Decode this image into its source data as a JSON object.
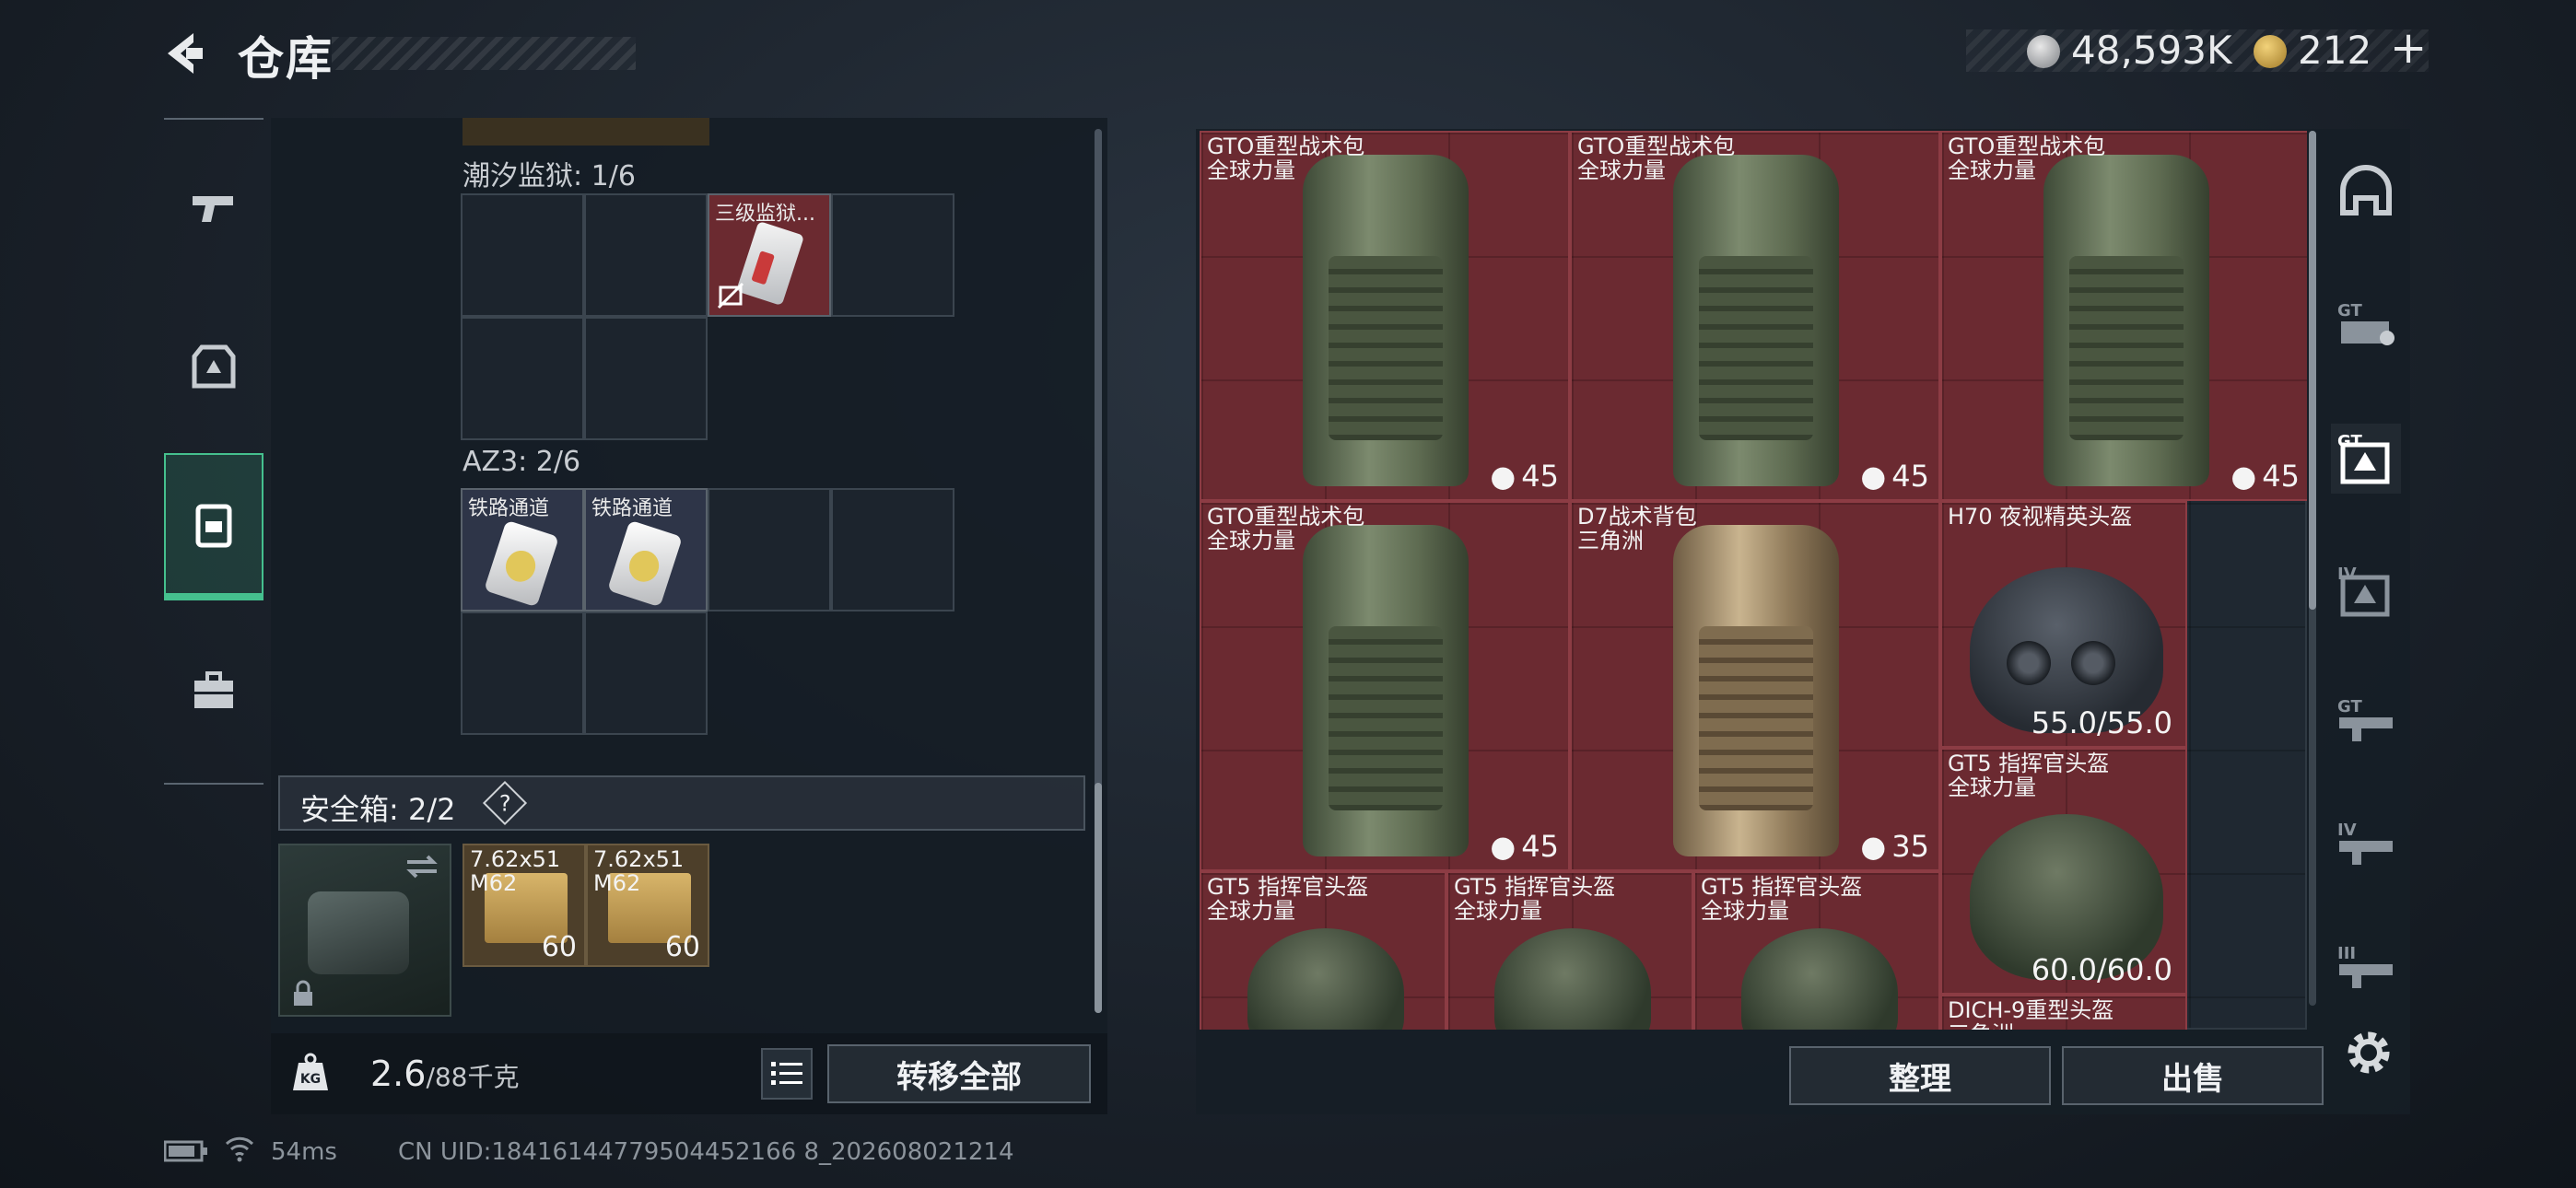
{
  "header": {
    "title": "仓库",
    "silver_value": "48,593K",
    "gold_value": "212",
    "plus": "+"
  },
  "rail": {
    "items": [
      "pistol-icon",
      "armor-icon",
      "backpack-icon",
      "case-icon"
    ],
    "active": 2
  },
  "containers": [
    {
      "label": "潮汐监狱: 1/6",
      "item": "三级监狱..."
    },
    {
      "label": "AZ3: 2/6",
      "items": [
        "铁路通道",
        "铁路通道"
      ]
    }
  ],
  "safebox": {
    "label": "安全箱: 2/2",
    "help": "?",
    "ammo": [
      {
        "line1": "7.62x51",
        "line2": "M62",
        "count": "60"
      },
      {
        "line1": "7.62x51",
        "line2": "M62",
        "count": "60"
      }
    ]
  },
  "footer": {
    "weight_current": "2.6",
    "weight_max": "/88千克",
    "transfer_all": "转移全部",
    "sort": "整理",
    "sell": "出售"
  },
  "stash": [
    {
      "name": "GTO重型战术包",
      "sub": "全球力量",
      "count": "45"
    },
    {
      "name": "GTO重型战术包",
      "sub": "全球力量",
      "count": "45"
    },
    {
      "name": "GTO重型战术包",
      "sub": "全球力量",
      "count": "45"
    },
    {
      "name": "GTO重型战术包",
      "sub": "全球力量",
      "count": "45"
    },
    {
      "name": "D7战术背包",
      "sub": "三角洲",
      "count": "35"
    },
    {
      "name": "H70 夜视精英头盔",
      "durability": "55.0/55.0"
    },
    {
      "name": "GT5 指挥官头盔",
      "sub": "全球力量",
      "durability": "60.0/60.0"
    },
    {
      "name": "GT5 指挥官头盔",
      "sub": "全球力量"
    },
    {
      "name": "GT5 指挥官头盔",
      "sub": "全球力量"
    },
    {
      "name": "GT5 指挥官头盔",
      "sub": "全球力量"
    },
    {
      "name": "DICH-9重型头盔",
      "sub": "三角洲"
    }
  ],
  "side_tabs": [
    "prison-helmet-icon",
    "gt-backpack-icon",
    "gt-armor-icon",
    "iv-armor-icon",
    "gt-rifle-icon",
    "iv-rifle-icon",
    "iii-rifle-icon"
  ],
  "status": {
    "ping": "54ms",
    "uid": "CN UID:18416144779504452166 8_202608021214"
  }
}
